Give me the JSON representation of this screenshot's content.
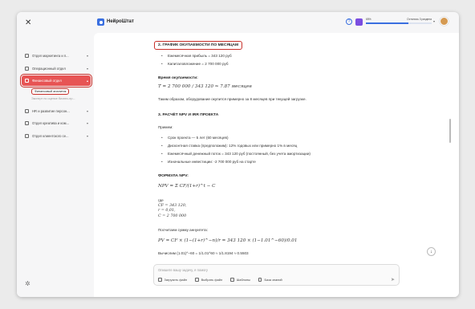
{
  "sidebar": {
    "close_glyph": "✕",
    "items": [
      {
        "label": "Отдел маркетинга и п...",
        "icon": "megaphone-icon"
      },
      {
        "label": "Операционный отдел",
        "icon": "briefcase-icon"
      },
      {
        "label": "Финансовый отдел",
        "icon": "wallet-icon",
        "active": true
      }
    ],
    "subitems": [
      {
        "label": "Финансовый аналитик",
        "selected": true
      },
      {
        "label": "Эксперт по оценке бизнес-пр...",
        "selected": false
      }
    ],
    "items_after": [
      {
        "label": "HR и развитие персон...",
        "icon": "people-icon"
      },
      {
        "label": "Отдел креатива и ком...",
        "icon": "chat-icon"
      },
      {
        "label": "Отдел клиентского се...",
        "icon": "headset-icon"
      }
    ],
    "settings_glyph": "✲"
  },
  "topbar": {
    "brand": "НейроШтат",
    "help_glyph": "?",
    "usage_percent_label": "65%",
    "usage_percent": 65,
    "usage_remaining": "Осталось 3 раздела",
    "accent": "#3a6fe0"
  },
  "doc": {
    "h_graph": "2. ГРАФИК ОКУПАЕМОСТИ ПО МЕСЯЦАМ",
    "graph_items": [
      "Ежемесячная прибыль = 343 120 руб",
      "Капиталовложение = 2 700 000 руб"
    ],
    "payback_title": "Время окупаемости:",
    "payback_formula": "T = 2 700 000 / 343 120 ≈ 7.87 месяцев",
    "payback_text": "Таким образом, оборудование окупится примерно за 8 месяцев при текущей загрузке.",
    "h_npv": "3. РАСЧЁТ NPV И IRR ПРОЕКТА",
    "assumptions_title": "Примем:",
    "assumptions": [
      "Срок проекта — 5 лет (60 месяцев)",
      "Дисконтная ставка (предположим): 12% годовых или примерно 1% в месяц",
      "Ежемесячный денежный поток = 343 120 руб (постоянный, без учета амортизации)",
      "Изначальные инвестиции: -2 700 000 руб на старте"
    ],
    "npv_title": "ФОРМУЛА NPV:",
    "npv_formula": "NPV = Σ CF/(1+r)^t − C",
    "where": "где",
    "cf": "CF = 343 120,",
    "r": "r = 0,01,",
    "c": "C = 2 700 000",
    "annuity_text": "Посчитаем сумму аннуитета:",
    "pv_formula": "PV = CF × (1−(1+r)^−n)/r = 343 120 × (1−1.01^−60)/0.01",
    "calc_formula": "Вычислим (1.01)^−60 = 1/1.01^60 ≈ 1/1.8194 ≈ 0.5503"
  },
  "chat": {
    "placeholder": "Опишите вашу задачу, я помогу",
    "tools": [
      {
        "label": "Загрузить файл",
        "icon": "paperclip-icon"
      },
      {
        "label": "Выбрать файл",
        "icon": "folder-icon"
      },
      {
        "label": "Шаблоны",
        "icon": "template-icon"
      },
      {
        "label": "База знаний",
        "icon": "book-icon"
      }
    ],
    "send_glyph": "➤",
    "scroll_down_glyph": "↓"
  }
}
